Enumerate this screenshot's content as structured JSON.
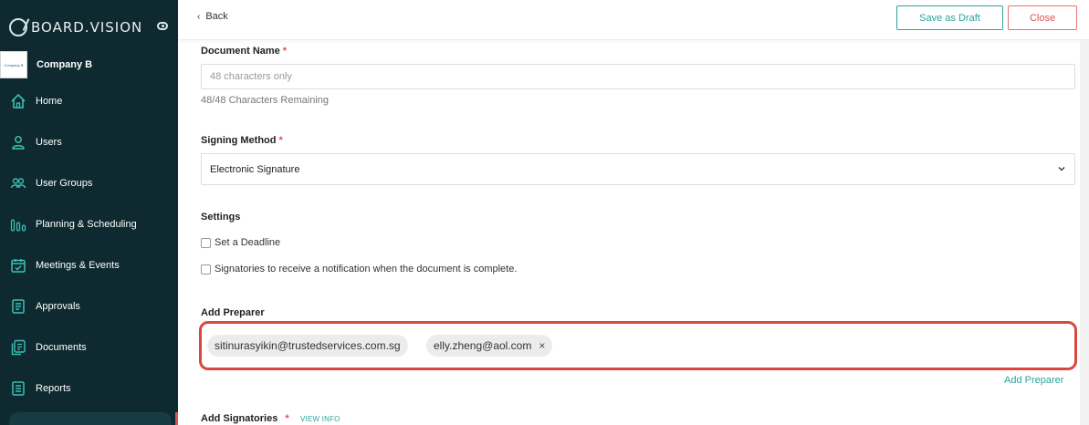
{
  "app": {
    "logo_text": "BOARD.VISION"
  },
  "company": {
    "logo_text": "Company B",
    "name": "Company B"
  },
  "nav": {
    "items": [
      {
        "label": "Home",
        "icon": "home-icon"
      },
      {
        "label": "Users",
        "icon": "user-icon"
      },
      {
        "label": "User Groups",
        "icon": "user-group-icon"
      },
      {
        "label": "Planning & Scheduling",
        "icon": "planning-icon"
      },
      {
        "label": "Meetings & Events",
        "icon": "calendar-icon"
      },
      {
        "label": "Approvals",
        "icon": "approvals-icon"
      },
      {
        "label": "Documents",
        "icon": "documents-icon"
      },
      {
        "label": "Reports",
        "icon": "reports-icon"
      }
    ]
  },
  "topbar": {
    "back_label": "Back",
    "save_draft_label": "Save as Draft",
    "close_label": "Close"
  },
  "form": {
    "document_name": {
      "label": "Document Name",
      "required_mark": "*",
      "placeholder": "48 characters only",
      "hint": "48/48 Characters Remaining"
    },
    "signing_method": {
      "label": "Signing Method",
      "required_mark": "*",
      "value": "Electronic Signature"
    },
    "settings": {
      "label": "Settings",
      "options": [
        {
          "label": "Set a Deadline",
          "checked": false
        },
        {
          "label": "Signatories to receive a notification when the document is complete.",
          "checked": false
        }
      ]
    },
    "preparer": {
      "label": "Add Preparer",
      "chips": [
        {
          "email": "sitinurasyikin@trustedservices.com.sg",
          "removable": false
        },
        {
          "email": "elly.zheng@aol.com",
          "removable": true,
          "remove_glyph": "×"
        }
      ],
      "add_link": "Add Preparer"
    },
    "signatories": {
      "label": "Add Signatories",
      "required_mark": "*",
      "info_link": "VIEW INFO"
    }
  },
  "colors": {
    "sidebar_bg": "#0e2a30",
    "accent": "#2aa39c",
    "danger": "#e0504d",
    "highlight_border": "#d9473f"
  }
}
